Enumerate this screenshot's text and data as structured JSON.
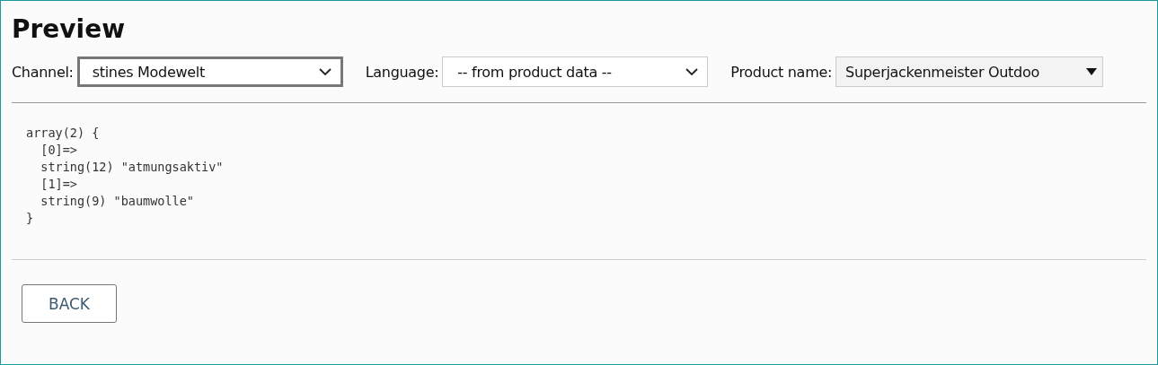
{
  "title": "Preview",
  "fields": [
    {
      "label": "Channel:",
      "value": "stines Modewelt",
      "kind": "chevron",
      "focused": true
    },
    {
      "label": "Language:",
      "value": "-- from product data --",
      "kind": "chevron",
      "focused": false
    },
    {
      "label": "Product name:",
      "value": "Superjackenmeister Outdoo",
      "kind": "triangle",
      "focused": false
    }
  ],
  "code_lines": [
    "array(2) {",
    "  [0]=>",
    "  string(12) \"atmungsaktiv\"",
    "  [1]=>",
    "  string(9) \"baumwolle\"",
    "}"
  ],
  "buttons": [
    "BACK"
  ]
}
